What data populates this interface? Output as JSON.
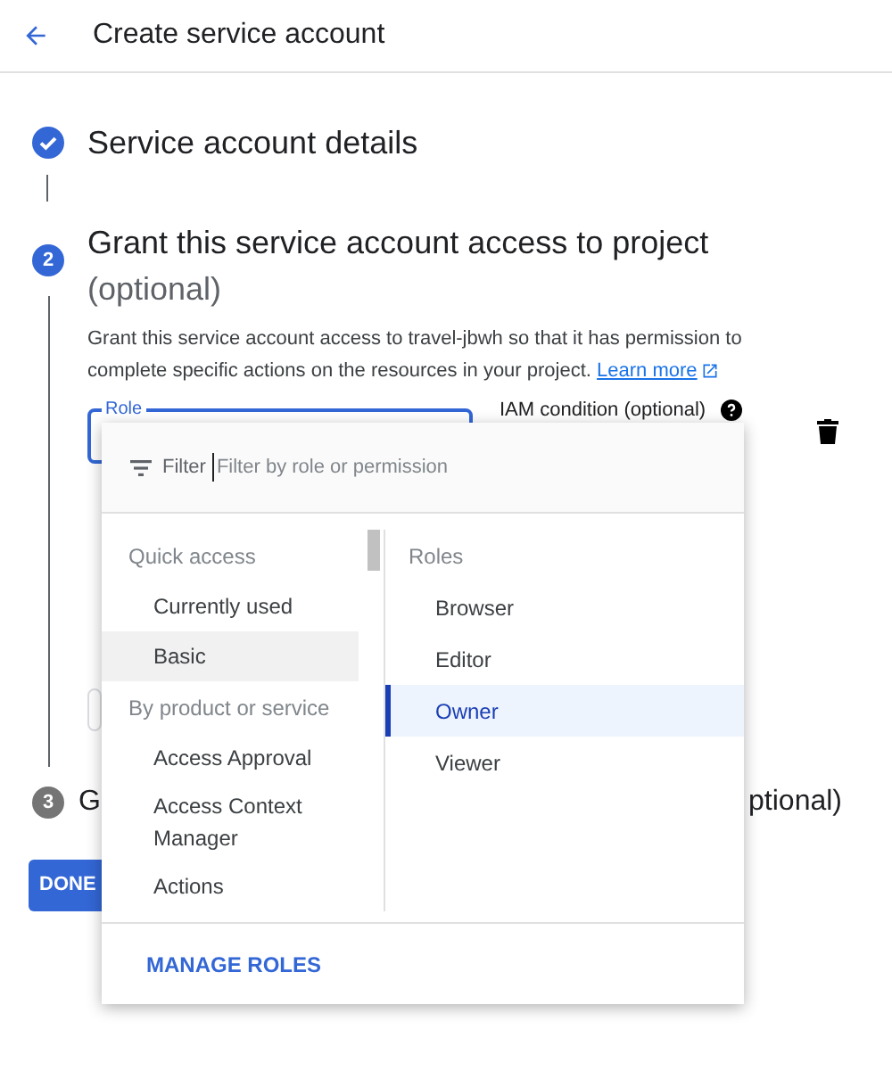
{
  "header": {
    "title": "Create service account"
  },
  "steps": [
    {
      "kind": "done",
      "title": "Service account details"
    },
    {
      "kind": "active",
      "number": "2",
      "title": "Grant this service account access to project",
      "optional": "(optional)",
      "description": "Grant this service account access to travel-jbwh so that it has permission to complete specific actions on the resources in your project.",
      "link": "Learn more",
      "role_field": {
        "label": "Role"
      },
      "condition_label": "IAM condition (optional)"
    },
    {
      "kind": "pending",
      "number": "3",
      "title_parts": [
        "G",
        "ptional)"
      ]
    }
  ],
  "done_button": "DONE",
  "role_menu": {
    "filter_label": "Filter",
    "placeholder": "Filter by role or permission",
    "groups": [
      {
        "header": "Quick access",
        "items": [
          {
            "label": "Currently used",
            "selected": false
          },
          {
            "label": "Basic",
            "selected": true
          }
        ]
      },
      {
        "header": "By product or service",
        "items": [
          {
            "label": "Access Approval",
            "selected": false
          },
          {
            "label": "Access Context Manager",
            "selected": false
          },
          {
            "label": "Actions",
            "selected": false
          }
        ]
      }
    ],
    "roles_header": "Roles",
    "roles": [
      {
        "label": "Browser",
        "selected": false
      },
      {
        "label": "Editor",
        "selected": false
      },
      {
        "label": "Owner",
        "selected": true
      },
      {
        "label": "Viewer",
        "selected": false
      }
    ],
    "manage_button": "MANAGE ROLES"
  }
}
